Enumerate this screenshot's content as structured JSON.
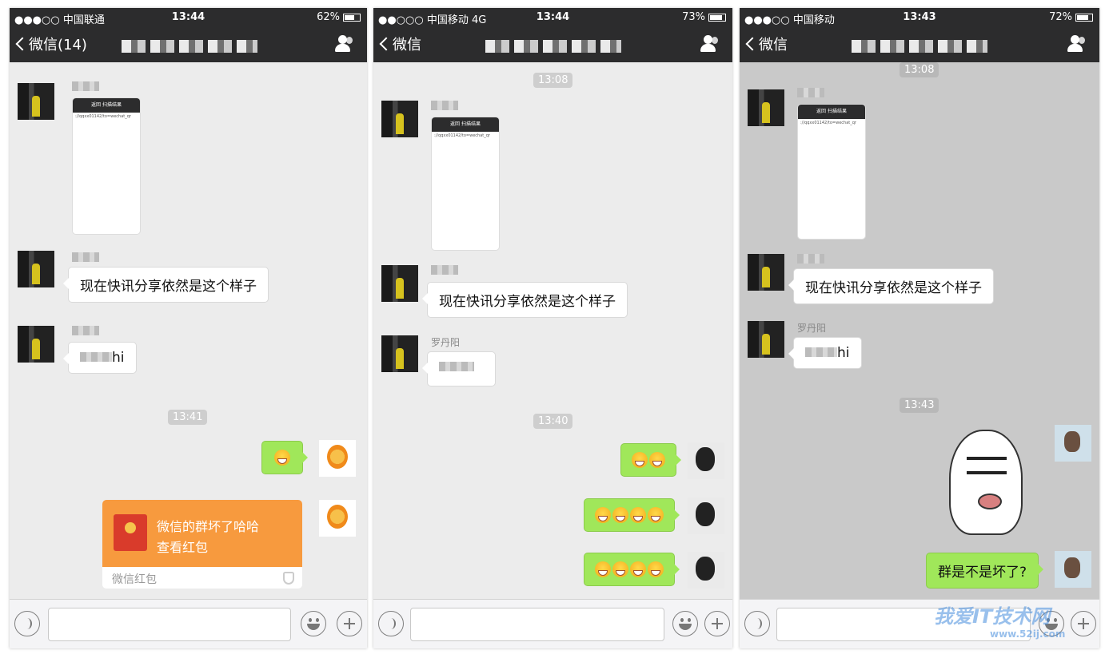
{
  "phone1": {
    "status": {
      "signal": "●●●○○ 中国联通",
      "time": "13:44",
      "battery": "62%",
      "battery_level": 0.62
    },
    "nav": {
      "back_label": "微信(14)"
    },
    "messages": {
      "text1": "现在快讯分享依然是这个样子",
      "text2_suffix": "hi",
      "timestamp": "13:41",
      "redpack_line1": "微信的群坏了哈哈",
      "redpack_line2": "查看红包",
      "redpack_footer": "微信红包"
    }
  },
  "phone2": {
    "status": {
      "signal": "●●○○○ 中国移动 4G",
      "time": "13:44",
      "battery": "73%",
      "battery_level": 0.73
    },
    "nav": {
      "back_label": "微信"
    },
    "messages": {
      "timestamp1": "13:08",
      "text1": "现在快讯分享依然是这个样子",
      "sender3": "罗丹阳",
      "timestamp2": "13:40"
    }
  },
  "phone3": {
    "status": {
      "signal": "●●●○○ 中国移动",
      "time": "13:43",
      "battery": "72%",
      "battery_level": 0.72
    },
    "nav": {
      "back_label": "微信"
    },
    "messages": {
      "timestamp1": "13:08",
      "text1": "现在快讯分享依然是这个样子",
      "sender3": "罗丹阳",
      "text2_suffix": "hi",
      "timestamp2": "13:43",
      "text3": "群是不是坏了?"
    }
  },
  "screenshot_header": {
    "text1": "返回",
    "text2": "扫描结果"
  },
  "watermark": {
    "brand": "我爱IT技术网",
    "site": "www.52ij.com"
  },
  "icons": [
    "chevron-left-icon",
    "group-person-icon",
    "voice-icon",
    "emoji-face-icon",
    "plus-icon",
    "shield-icon",
    "red-envelope-icon"
  ]
}
